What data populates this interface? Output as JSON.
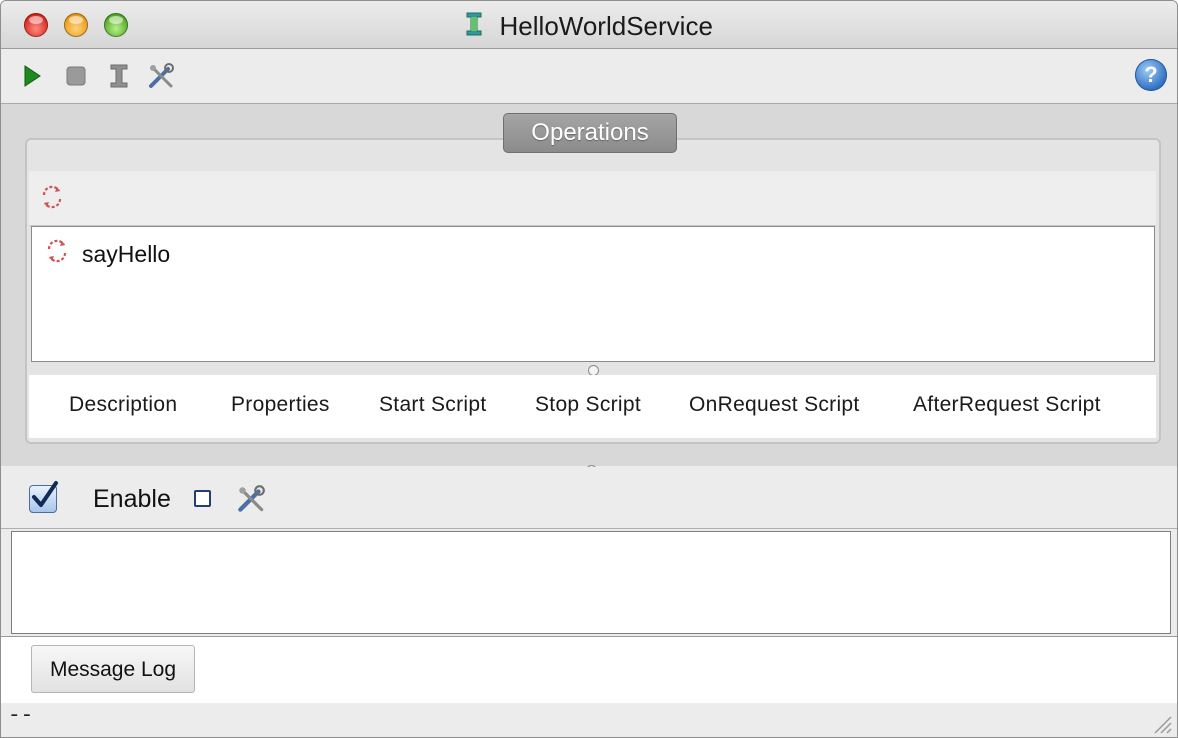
{
  "window": {
    "title": "HelloWorldService",
    "controls": [
      "close",
      "minimize",
      "zoom"
    ]
  },
  "toolbar": {
    "icons": [
      "run-icon",
      "stop-icon",
      "service-icon",
      "settings-icon"
    ],
    "help_icon": "help-icon",
    "help_glyph": "?"
  },
  "operations": {
    "tab_label": "Operations",
    "toolbar_icon": "operation-icon",
    "items": [
      {
        "label": "sayHello",
        "icon": "operation-icon"
      }
    ],
    "tabs": [
      "Description",
      "Properties",
      "Start Script",
      "Stop Script",
      "OnRequest Script",
      "AfterRequest Script"
    ]
  },
  "enable_bar": {
    "enable_label": "Enable",
    "enable_checked": true
  },
  "message_log": {
    "button_label": "Message Log",
    "content": ""
  },
  "status": {
    "text": "--"
  },
  "colors": {
    "run_green": "#1f8a1f",
    "tab_gray": "#969696",
    "help_blue": "#2f6fc1",
    "checkbox_blue": "#1f3f7a"
  }
}
